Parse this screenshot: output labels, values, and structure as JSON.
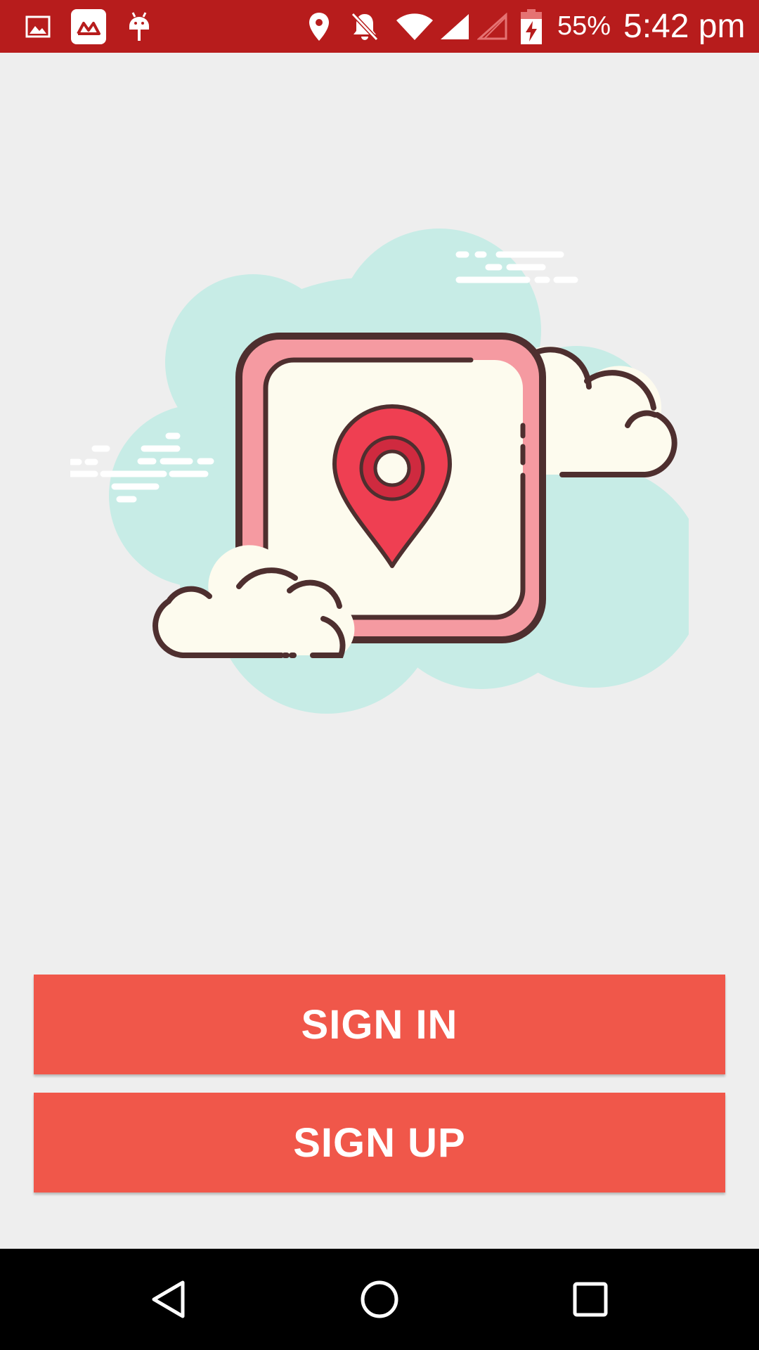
{
  "status_bar": {
    "battery_percent": "55%",
    "time": "5:42 pm",
    "icons": [
      "gallery-icon",
      "app-logo-icon",
      "android-debug-icon",
      "location-icon",
      "notifications-off-icon",
      "wifi-icon",
      "signal-icon",
      "signal-no-service-icon",
      "battery-charging-icon"
    ]
  },
  "illustration": {
    "icon": "map-pin-in-square-with-clouds"
  },
  "actions": {
    "sign_in_label": "SIGN IN",
    "sign_up_label": "SIGN UP"
  },
  "navigation": {
    "buttons": [
      "back-icon",
      "home-icon",
      "recents-icon"
    ]
  },
  "colors": {
    "status_bar": "#b71c1c",
    "background": "#eeeeee",
    "button": "#f0574a",
    "pin": "#ef3f52",
    "nav_bar": "#000000"
  }
}
